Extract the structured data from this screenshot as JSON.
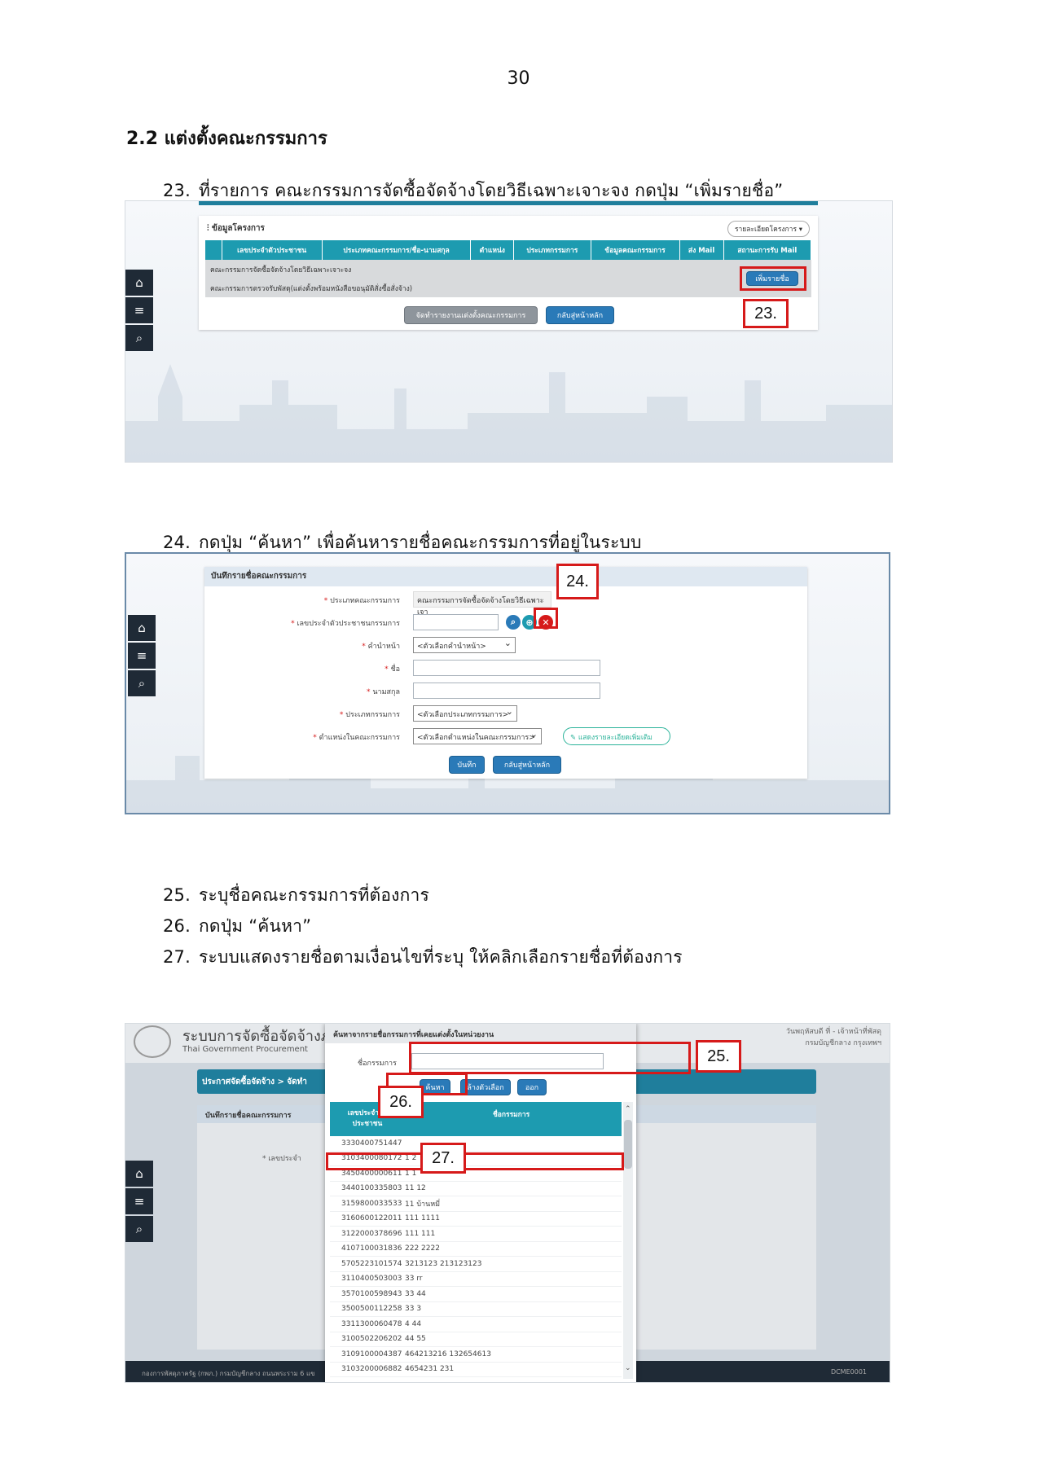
{
  "page_number": "30",
  "section_title": "2.2 แต่งตั้งคณะกรรมการ",
  "steps": {
    "s23": {
      "num": "23.",
      "text": "ที่รายการ คณะกรรมการจัดซื้อจัดจ้างโดยวิธีเฉพาะเจาะจง กดปุ่ม “เพิ่มรายชื่อ”"
    },
    "s24": {
      "num": "24.",
      "text": "กดปุ่ม “ค้นหา” เพื่อค้นหารายชื่อคณะกรรมการที่อยู่ในระบบ"
    },
    "s25": {
      "num": "25.",
      "text": "ระบุชื่อคณะกรรมการที่ต้องการ"
    },
    "s26": {
      "num": "26.",
      "text": "กดปุ่ม “ค้นหา”"
    },
    "s27": {
      "num": "27.",
      "text": "ระบบแสดงรายชื่อตามเงื่อนไขที่ระบุ ให้คลิกเลือกรายชื่อที่ต้องการ"
    }
  },
  "shot1": {
    "panel_title": "ข้อมูลโครงการ",
    "project_detail_button": "รายละเอียดโครงการ ▾",
    "columns": [
      "เลขประจำตัวประชาชน",
      "ประเภทคณะกรรมการ/ชื่อ-นามสกุล",
      "ตำแหน่ง",
      "ประเภทกรรมการ",
      "ข้อมูลคณะกรรมการ",
      "ส่ง Mail",
      "สถานะการรับ Mail"
    ],
    "rows": [
      "คณะกรรมการจัดซื้อจัดจ้างโดยวิธีเฉพาะเจาะจง",
      "คณะกรรมการตรวจรับพัสดุ(แต่งตั้งพร้อมหนังสือขอนุมัติสั่งซื้อสั่งจ้าง)"
    ],
    "add_name_button": "เพิ่มรายชื่อ",
    "print_button": "จัดทำรายงานแต่งตั้งคณะกรรมการ",
    "back_button": "กลับสู่หน้าหลัก",
    "callout": "23."
  },
  "shot2": {
    "panel_title": "บันทึกรายชื่อคณะกรรมการ",
    "fields": {
      "committee_type": {
        "label": "ประเภทคณะกรรมการ",
        "value": "คณะกรรมการจัดซื้อจัดจ้างโดยวิธีเฉพาะเจา"
      },
      "id_number": {
        "label": "เลขประจำตัวประชาชนกรรมการ",
        "value": ""
      },
      "prefix": {
        "label": "คำนำหน้า",
        "value": "<ตัวเลือกคำนำหน้า>"
      },
      "first_name": {
        "label": "ชื่อ",
        "value": ""
      },
      "last_name": {
        "label": "นามสกุล",
        "value": ""
      },
      "member_type": {
        "label": "ประเภทกรรมการ",
        "value": "<ตัวเลือกประเภทกรรมการ>"
      },
      "position": {
        "label": "ตำแหน่งในคณะกรรมการ",
        "value": "<ตัวเลือกตำแหน่งในคณะกรรมการ>"
      }
    },
    "more_detail_button": "แสดงรายละเอียดเพิ่มเติม",
    "save_button": "บันทึก",
    "back_button": "กลับสู่หน้าหลัก",
    "callout": "24."
  },
  "shot3": {
    "system_title": "ระบบการจัดซื้อจัดจ้างภาครัฐ",
    "system_subtitle": "Thai Government Procurement",
    "breadcrumb": "ประกาศจัดซื้อจัดจ้าง > จัดทำ",
    "right_header_1": "วันพฤหัสบดี ที่ - เจ้าหน้าที่พัสดุ",
    "right_header_2": "กรมบัญชีกลาง กรุงเทพฯ",
    "bg_panel_title": "บันทึกรายชื่อคณะกรรมการ",
    "bg_label": "* เลขประจำ",
    "footer_left": "กองการพัสดุภาครัฐ (กพภ.) กรมบัญชีกลาง ถนนพระราม 6 แข",
    "footer_right": "DCME0001",
    "modal_title": "ค้นหาจากรายชื่อกรรมการที่เคยแต่งตั้งในหน่วยงาน",
    "name_label": "ชื่อกรรมการ",
    "name_value": "",
    "search_button": "ค้นหา",
    "clear_button": "ล้างตัวเลือก",
    "close_button": "ออก",
    "col_id": "เลขประจำตัว ประชาชน",
    "col_name": "ชื่อกรรมการ",
    "rows": [
      {
        "id": "3330400751447",
        "name": ""
      },
      {
        "id": "3103400080172",
        "name": "1 2"
      },
      {
        "id": "3450400000611",
        "name": "1 1"
      },
      {
        "id": "3440100335803",
        "name": "11 12"
      },
      {
        "id": "3159800033533",
        "name": "11 บ้านหมี่"
      },
      {
        "id": "3160600122011",
        "name": "111 1111"
      },
      {
        "id": "3122000378696",
        "name": "111 111"
      },
      {
        "id": "4107100031836",
        "name": "222 2222"
      },
      {
        "id": "5705223101574",
        "name": "3213123 213123123"
      },
      {
        "id": "3110400503003",
        "name": "33 rr"
      },
      {
        "id": "3570100598943",
        "name": "33 44"
      },
      {
        "id": "3500500112258",
        "name": "33 3"
      },
      {
        "id": "3311300060478",
        "name": "4 44"
      },
      {
        "id": "3100502206202",
        "name": "44 55"
      },
      {
        "id": "3109100004387",
        "name": "464213216 132654613"
      },
      {
        "id": "3103200006882",
        "name": "4654231 231"
      }
    ],
    "callout_25": "25.",
    "callout_26": "26.",
    "callout_27": "27."
  }
}
